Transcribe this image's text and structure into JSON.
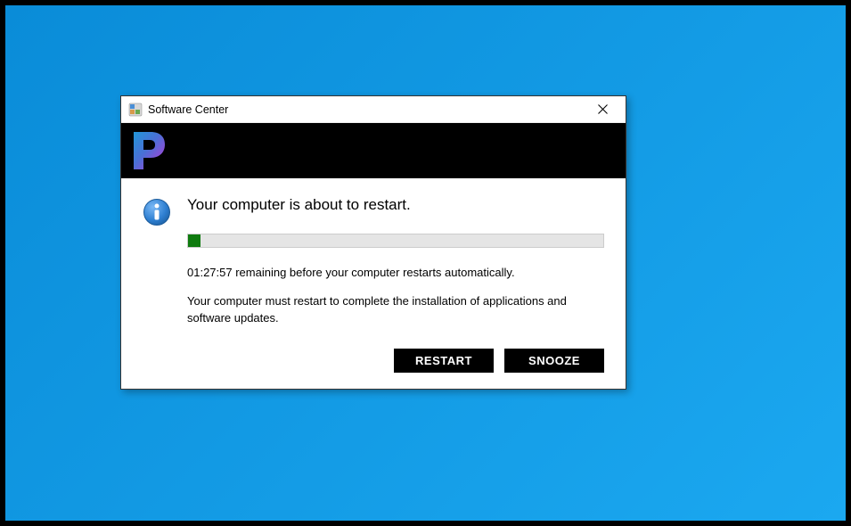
{
  "window": {
    "title": "Software Center"
  },
  "dialog": {
    "heading": "Your computer is about to restart.",
    "progress_percent": 3,
    "remaining_text": "01:27:57 remaining before your computer restarts automatically.",
    "reason_text": "Your computer must restart to complete the installation of applications and software updates.",
    "restart_button": "RESTART",
    "snooze_button": "SNOOZE"
  },
  "colors": {
    "progress_fill": "#0f7b0f",
    "banner_bg": "#000000",
    "button_bg": "#000000"
  }
}
